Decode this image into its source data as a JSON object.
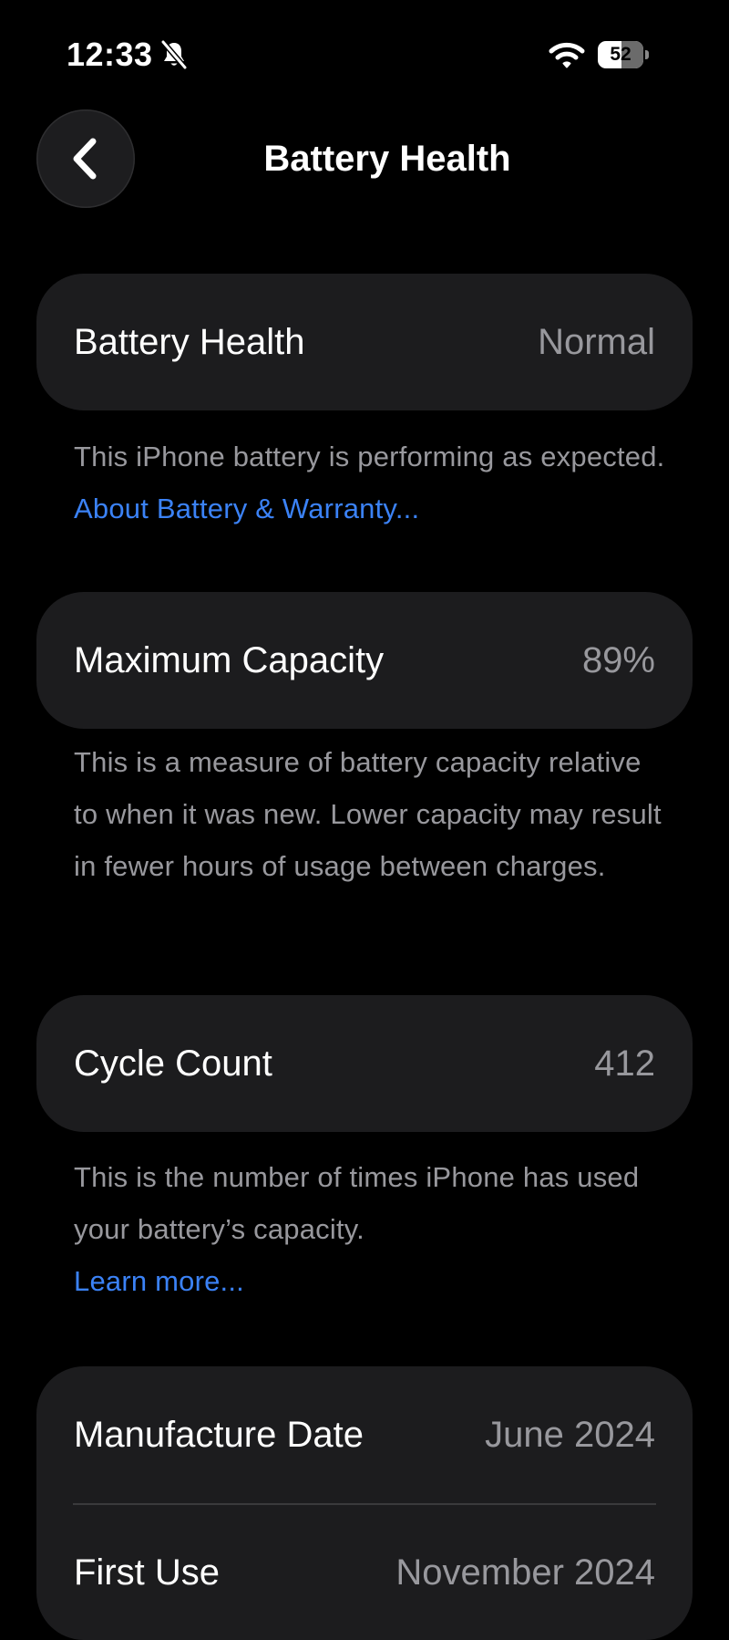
{
  "status_bar": {
    "time": "12:33",
    "battery_level": "52",
    "battery_fraction": 0.52,
    "icons": [
      "bell-slash-icon",
      "wifi-icon",
      "battery-icon"
    ]
  },
  "header": {
    "title": "Battery Health",
    "back_icon": "chevron-left-icon"
  },
  "sections": {
    "health": {
      "label": "Battery Health",
      "value": "Normal",
      "footer": "This iPhone battery is performing as expected.",
      "link": "About Battery & Warranty..."
    },
    "capacity": {
      "label": "Maximum Capacity",
      "value": "89%",
      "footer": "This is a measure of battery capacity relative to when it was new. Lower capacity may result in fewer hours of usage between charges."
    },
    "cycles": {
      "label": "Cycle Count",
      "value": "412",
      "footer": "This is the number of times iPhone has used your battery’s capacity.",
      "link": "Learn more..."
    },
    "dates": {
      "manufacture_label": "Manufacture Date",
      "manufacture_value": "June 2024",
      "first_use_label": "First Use",
      "first_use_value": "November 2024"
    }
  },
  "colors": {
    "background": "#000000",
    "card": "#1c1c1e",
    "secondary_text": "#98989d",
    "link": "#3b82f6",
    "divider": "#3a3a3c"
  }
}
